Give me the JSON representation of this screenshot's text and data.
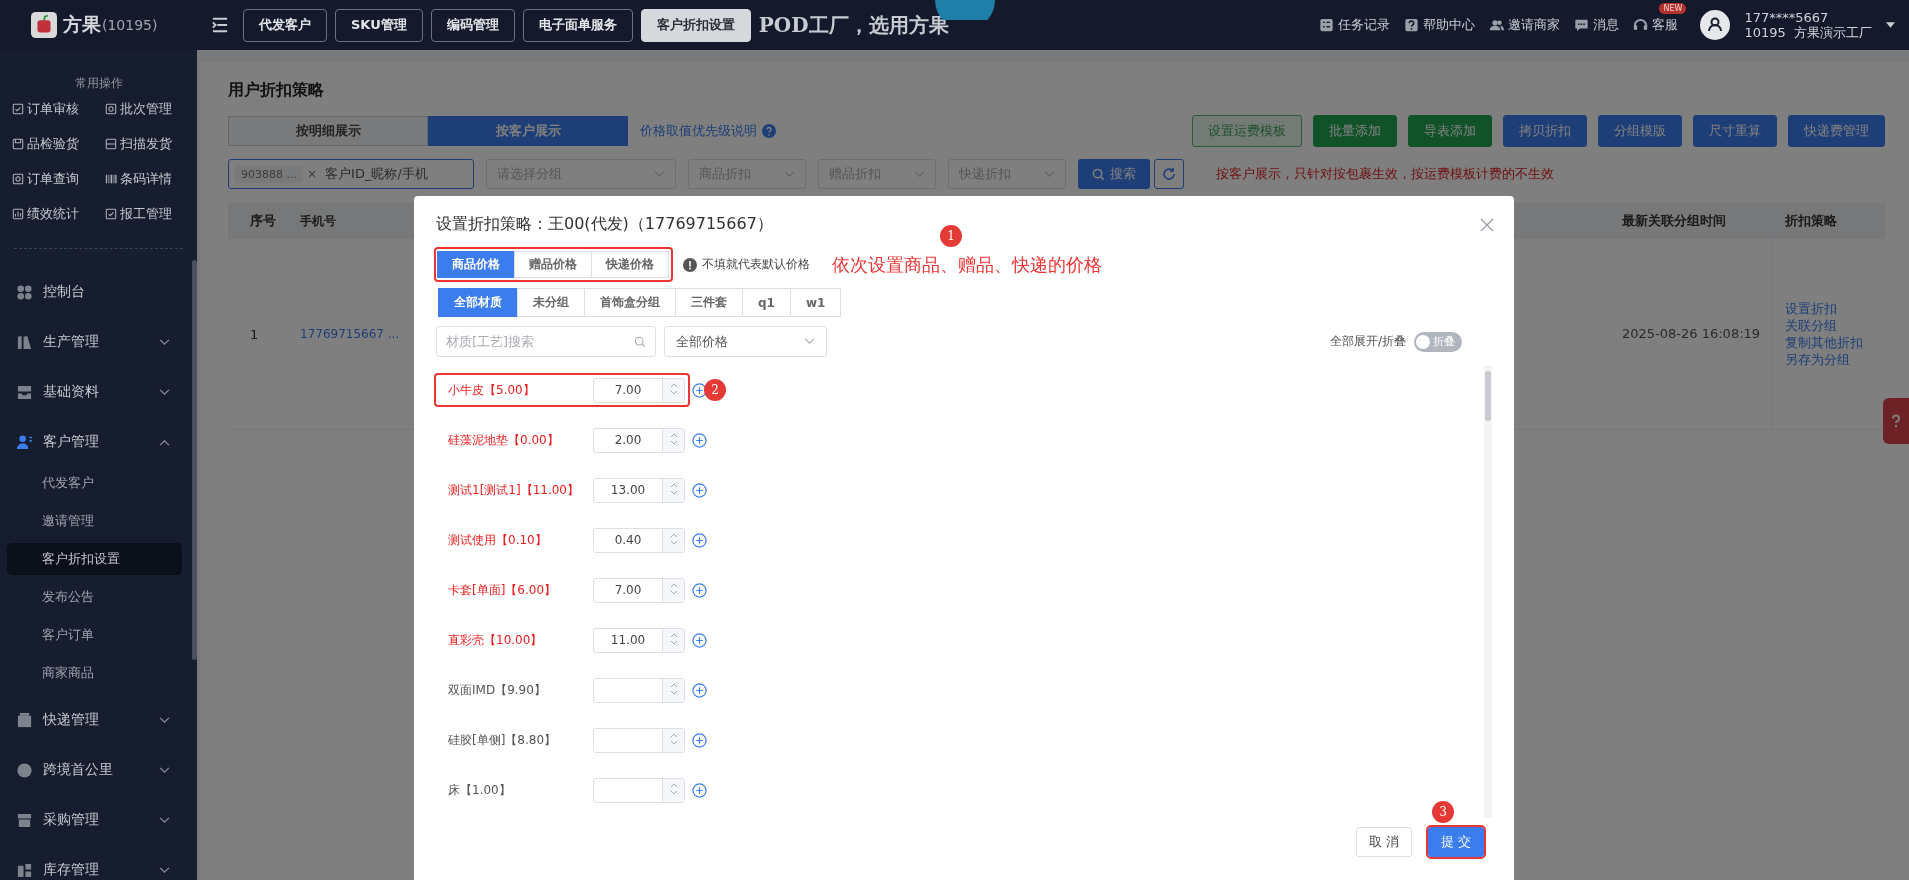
{
  "topbar": {
    "brand": "方果",
    "brand_id": "(10195)",
    "tabs": [
      {
        "label": "代发客户",
        "selected": false
      },
      {
        "label": "SKU管理",
        "selected": false
      },
      {
        "label": "编码管理",
        "selected": false
      },
      {
        "label": "电子面单服务",
        "selected": false
      },
      {
        "label": "客户折扣设置",
        "selected": true
      }
    ],
    "banner": "POD工厂，选用方果",
    "actions": [
      {
        "label": "任务记录",
        "kind": "task"
      },
      {
        "label": "帮助中心",
        "kind": "help"
      },
      {
        "label": "邀请商家",
        "kind": "invite"
      },
      {
        "label": "消息",
        "kind": "message"
      },
      {
        "label": "客服",
        "kind": "service",
        "badge": "NEW"
      }
    ],
    "user": {
      "phone": "177****5667",
      "org": "10195  方果演示工厂"
    }
  },
  "sidebar": {
    "quick_title": "常用操作",
    "quick_items": [
      {
        "label": "订单审核",
        "kind": "check"
      },
      {
        "label": "批次管理",
        "kind": "search"
      },
      {
        "label": "品检验货",
        "kind": "box"
      },
      {
        "label": "扫描发货",
        "kind": "scan"
      },
      {
        "label": "订单查询",
        "kind": "search"
      },
      {
        "label": "条码详情",
        "kind": "barcode"
      },
      {
        "label": "绩效统计",
        "kind": "chart"
      },
      {
        "label": "报工管理",
        "kind": "check"
      }
    ],
    "menu": [
      {
        "label": "控制台",
        "kind": "link"
      },
      {
        "label": "生产管理",
        "kind": "group",
        "expanded": false
      },
      {
        "label": "基础资料",
        "kind": "group",
        "expanded": false
      },
      {
        "label": "客户管理",
        "kind": "group",
        "expanded": true,
        "children": [
          {
            "label": "代发客户",
            "selected": false
          },
          {
            "label": "邀请管理",
            "selected": false
          },
          {
            "label": "客户折扣设置",
            "selected": true
          },
          {
            "label": "发布公告",
            "selected": false
          },
          {
            "label": "客户订单",
            "selected": false
          },
          {
            "label": "商家商品",
            "selected": false
          }
        ]
      },
      {
        "label": "快递管理",
        "kind": "group",
        "expanded": false
      },
      {
        "label": "跨境首公里",
        "kind": "group",
        "expanded": false
      },
      {
        "label": "采购管理",
        "kind": "group",
        "expanded": false
      },
      {
        "label": "库存管理",
        "kind": "group",
        "expanded": false
      }
    ]
  },
  "page": {
    "title": "用户折扣策略",
    "view_toggle": [
      {
        "label": "按明细展示",
        "selected": false
      },
      {
        "label": "按客户展示",
        "selected": true
      }
    ],
    "help_link": "价格取值优先级说明",
    "buttons": [
      {
        "label": "设置运费模板",
        "kind": "outline"
      },
      {
        "label": "批量添加",
        "kind": "green"
      },
      {
        "label": "导表添加",
        "kind": "green"
      },
      {
        "label": "拷贝折扣",
        "kind": "blue"
      },
      {
        "label": "分组模版",
        "kind": "blue"
      },
      {
        "label": "尺寸重算",
        "kind": "blue"
      },
      {
        "label": "快递费管理",
        "kind": "blue"
      }
    ],
    "filter": {
      "tag": "903888 ...",
      "tag_close": "×",
      "id_field": "客户ID_昵称/手机",
      "selects": [
        "请选择分组",
        "商品折扣",
        "赠品折扣",
        "快递折扣"
      ],
      "search_button": "搜索",
      "notice": "按客户展示，只针对按包裹生效，按运费模板计费的不生效"
    },
    "table": {
      "columns": [
        "序号",
        "手机号",
        "最新关联分组时间",
        "折扣策略"
      ],
      "rows": [
        {
          "index": "1",
          "phone": "17769715667 ...",
          "time": "2025-08-26 16:08:19",
          "actions": [
            "设置折扣",
            "关联分组",
            "复制其他折扣",
            "另存为分组"
          ]
        }
      ]
    }
  },
  "modal": {
    "title": "设置折扣策略：王00(代发)（17769715667）",
    "price_tabs": [
      {
        "label": "商品价格",
        "selected": true
      },
      {
        "label": "赠品价格",
        "selected": false
      },
      {
        "label": "快递价格",
        "selected": false
      }
    ],
    "hint": "不填就代表默认价格",
    "group_tabs": [
      {
        "label": "全部材质",
        "selected": true
      },
      {
        "label": "未分组",
        "selected": false
      },
      {
        "label": "首饰盒分组",
        "selected": false
      },
      {
        "label": "三件套",
        "selected": false
      },
      {
        "label": "q1",
        "selected": false
      },
      {
        "label": "w1",
        "selected": false
      }
    ],
    "search_placeholder": "材质[工艺]搜索",
    "price_filter": "全部价格",
    "expand_label": "全部展开/折叠",
    "toggle": {
      "label": "折叠",
      "on": false
    },
    "items": [
      {
        "name": "小牛皮【5.00】",
        "value": "7.00",
        "modified": true
      },
      {
        "name": "硅藻泥地垫【0.00】",
        "value": "2.00",
        "modified": true
      },
      {
        "name": "测试1[测试1]【11.00】",
        "value": "13.00",
        "modified": true
      },
      {
        "name": "测试使用【0.10】",
        "value": "0.40",
        "modified": true
      },
      {
        "name": "卡套[单面]【6.00】",
        "value": "7.00",
        "modified": true
      },
      {
        "name": "直彩壳【10.00】",
        "value": "11.00",
        "modified": true
      },
      {
        "name": "双面IMD【9.90】",
        "modified": false
      },
      {
        "name": "硅胶[单侧]【8.80】",
        "modified": false
      },
      {
        "name": "床【1.00】",
        "modified": false
      }
    ],
    "cancel": "取 消",
    "submit": "提 交"
  },
  "annotations": {
    "note": "依次设置商品、赠品、快递的价格",
    "marks": [
      {
        "number": "1"
      },
      {
        "number": "2"
      },
      {
        "number": "3"
      }
    ]
  }
}
